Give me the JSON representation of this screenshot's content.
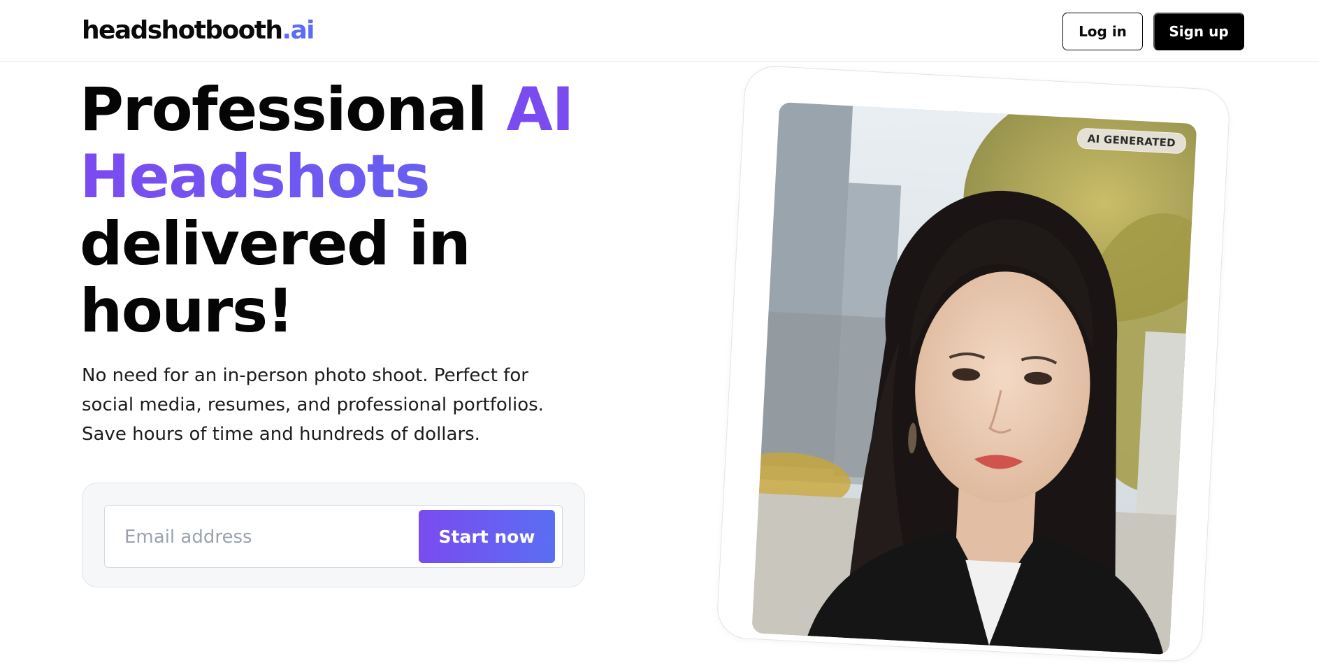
{
  "header": {
    "brand_main": "headshotbooth",
    "brand_tld": ".ai",
    "login_label": "Log in",
    "signup_label": "Sign up"
  },
  "hero": {
    "title_line1_plain": "Professional ",
    "title_line1_accent": "AI",
    "title_line2_accent": "Headshots",
    "title_line3": "delivered in",
    "title_line4": "hours!",
    "subtitle": "No need for an in-person photo shoot. Perfect for social media, resumes, and professional portfolios. Save hours of time and hundreds of dollars."
  },
  "signup_form": {
    "email_placeholder": "Email address",
    "email_value": "",
    "start_label": "Start now"
  },
  "photo_card": {
    "badge": "AI GENERATED"
  },
  "colors": {
    "accent_purple": "#7a4cf0",
    "accent_blue": "#5b6cf5",
    "button_dark": "#000000"
  },
  "icons": [
    "ai-generated-badge"
  ]
}
